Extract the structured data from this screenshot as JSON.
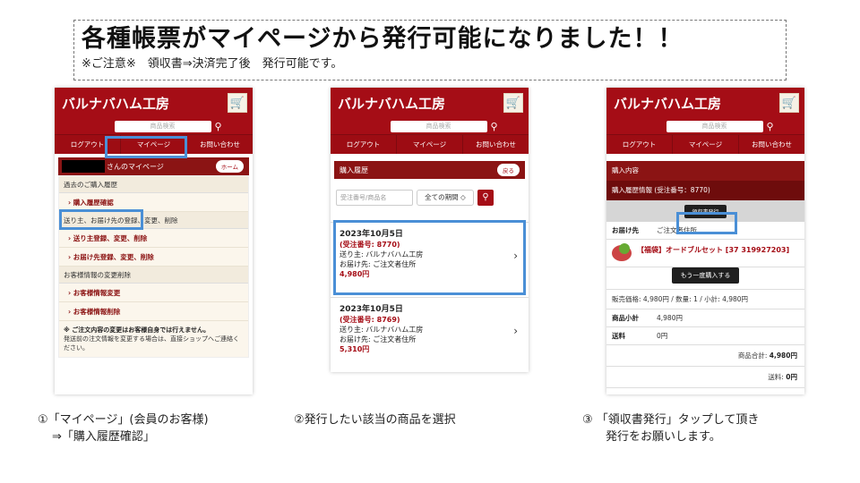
{
  "banner": {
    "title": "各種帳票がマイページから発行可能になりました！！",
    "subtitle": "※ご注意※　領収書⇒決済完了後　発行可能です。"
  },
  "common": {
    "brand": "バルナバハム工房",
    "search_placeholder": "商品検索",
    "nav": [
      "ログアウト",
      "マイページ",
      "お問い合わせ"
    ],
    "cart_icon": "cart-icon",
    "search_icon": "search-icon"
  },
  "phone1": {
    "header_suffix": "さんのマイページ",
    "home_label": "ホーム",
    "sections": [
      {
        "title": "過去のご購入履歴",
        "links": [
          "› 購入履歴確認"
        ]
      },
      {
        "title": "送り主、お届け先の登録、変更、削除",
        "links": [
          "› 送り主登録、変更、削除",
          "› お届け先登録、変更、削除"
        ]
      },
      {
        "title": "お客様情報の変更削除",
        "links": [
          "› お客様情報変更",
          "› お客様情報削除"
        ]
      }
    ],
    "note_bold": "※ ご注文内容の変更はお客様自身では行えません。",
    "note_text": "発送前の注文情報を変更する場合は、直接ショップへご連絡ください。"
  },
  "phone2": {
    "title": "購入履歴",
    "back": "戻る",
    "order_placeholder": "受注番号/商品名",
    "period": "全ての期間 ◇",
    "orders": [
      {
        "date": "2023年10月5日",
        "no": "(受注番号: 8770)",
        "sender": "送り主: バルナバハム工房",
        "dest": "お届け先: ご注文者住所",
        "price": "4,980円"
      },
      {
        "date": "2023年10月5日",
        "no": "(受注番号: 8769)",
        "sender": "送り主: バルナバハム工房",
        "dest": "お届け先: ご注文者住所",
        "price": "5,310円"
      }
    ]
  },
  "phone3": {
    "section": "購入内容",
    "history": "購入履歴情報 (受注番号：8770)",
    "receipt_btn": "領収書発行",
    "dest_label": "お届け先",
    "dest_value": "ご注文者住所",
    "product": "【福袋】オードブルセット [37 319927203]",
    "again_btn": "もう一度購入する",
    "price_line": "販売価格: 4,980円 / 数量: 1 / 小計: 4,980円",
    "subtotal_label": "商品小計",
    "subtotal_value": "4,980円",
    "shipping_label": "送料",
    "shipping_value": "0円",
    "total_label": "商品合計: ",
    "total_value": "4,980円",
    "ship_label": "送料: ",
    "ship_value": "0円"
  },
  "captions": {
    "c1_line1": "①「マイページ」(会員のお客様)",
    "c1_line2": "⇒「購入履歴確認」",
    "c2": "②発行したい該当の商品を選択",
    "c3_line1": "③ 「領収書発行」タップして頂き",
    "c3_line2": "発行をお願いします。"
  },
  "colors": {
    "brand_red": "#a50d16",
    "highlight": "#4a8fd6"
  }
}
